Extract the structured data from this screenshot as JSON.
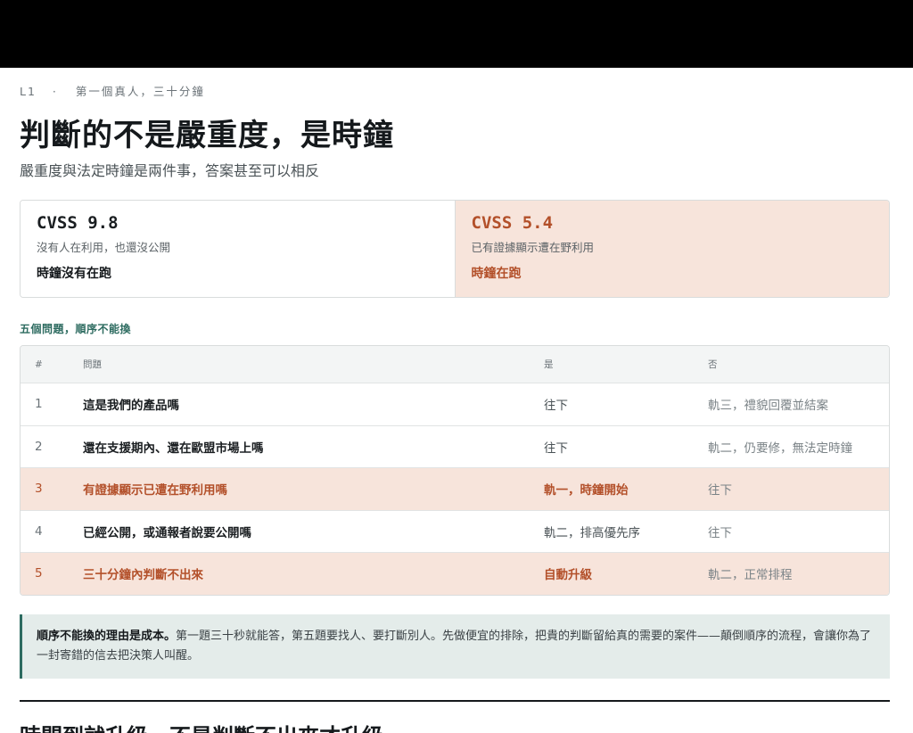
{
  "breadcrumb": {
    "level": "L1",
    "separator": "·",
    "section": "第一個真人，三十分鐘"
  },
  "title": "判斷的不是嚴重度，是時鐘",
  "subtitle": "嚴重度與法定時鐘是兩件事，答案甚至可以相反",
  "comparison": {
    "left": {
      "score": "CVSS 9.8",
      "description": "沒有人在利用，也還沒公開",
      "clock": "時鐘沒有在跑"
    },
    "right": {
      "score": "CVSS 5.4",
      "description": "已有證據顯示遭在野利用",
      "clock": "時鐘在跑"
    }
  },
  "questions_label": "五個問題，順序不能換",
  "table": {
    "headers": {
      "num": "#",
      "question": "問題",
      "yes": "是",
      "no": "否"
    },
    "rows": [
      {
        "num": "1",
        "question": "這是我們的產品嗎",
        "yes": "往下",
        "no": "軌三，禮貌回覆並結案"
      },
      {
        "num": "2",
        "question": "還在支援期內、還在歐盟市場上嗎",
        "yes": "往下",
        "no": "軌二，仍要修，無法定時鐘"
      },
      {
        "num": "3",
        "question": "有證據顯示已遭在野利用嗎",
        "yes": "軌一，時鐘開始",
        "no": "往下"
      },
      {
        "num": "4",
        "question": "已經公開，或通報者說要公開嗎",
        "yes": "軌二，排高優先序",
        "no": "往下"
      },
      {
        "num": "5",
        "question": "三十分鐘內判斷不出來",
        "yes": "自動升級",
        "no": "軌二，正常排程"
      }
    ]
  },
  "note": {
    "lead": "順序不能換的理由是成本。",
    "body": "第一題三十秒就能答，第五題要找人、要打斷別人。先做便宜的排除，把貴的判斷留給真的需要的案件——顛倒順序的流程，會讓你為了一封寄錯的信去把決策人叫醒。"
  },
  "bottom_heading": "時間到就升級，不是判斷不出來才升級。",
  "colors": {
    "accent": "#b3502a",
    "highlight_bg": "#f7e4db",
    "teal": "#2d6b60",
    "note_bg": "#e4ecea"
  }
}
